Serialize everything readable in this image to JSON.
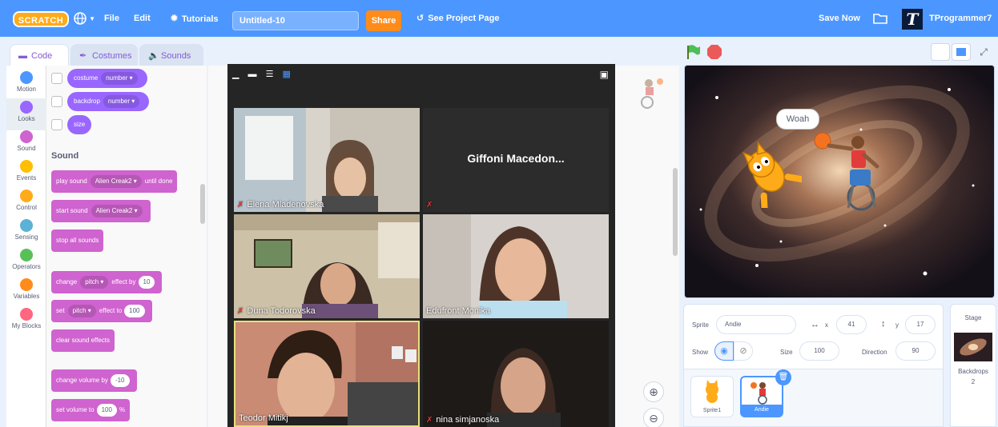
{
  "menu": {
    "logo": "SCRATCH",
    "file": "File",
    "edit": "Edit",
    "tutorials": "Tutorials",
    "project_title": "Untitled-10",
    "share": "Share",
    "see_project_page": "See Project Page",
    "save_now": "Save Now",
    "avatar_letter": "T",
    "username": "TProgrammer7"
  },
  "tabs": {
    "code": "Code",
    "costumes": "Costumes",
    "sounds": "Sounds"
  },
  "categories": [
    "Motion",
    "Looks",
    "Sound",
    "Events",
    "Control",
    "Sensing",
    "Operators",
    "Variables",
    "My Blocks"
  ],
  "category_colors": [
    "#4c97ff",
    "#9966ff",
    "#cf63cf",
    "#ffbf00",
    "#ffab19",
    "#5cb1d6",
    "#59c059",
    "#ff8c1a",
    "#ff6680"
  ],
  "looks_blocks": {
    "costume": "costume",
    "costume_opt": "number",
    "backdrop": "backdrop",
    "backdrop_opt": "number",
    "size": "size"
  },
  "sound_section": "Sound",
  "sound_blocks": {
    "play_sound": "play sound",
    "sound_name": "Alien Creak2",
    "until_done": "until done",
    "start_sound": "start sound",
    "start_sound_name": "Alien Creak2",
    "stop_all": "stop all sounds",
    "change": "change",
    "pitch": "pitch",
    "effect_by": "effect by",
    "effect_by_val": "10",
    "set": "set",
    "set_pitch": "pitch",
    "effect_to": "effect to",
    "effect_to_val": "100",
    "clear": "clear sound effects",
    "change_volume": "change volume by",
    "change_volume_val": "-10",
    "set_volume": "set volume to",
    "set_volume_val": "100",
    "percent": "%"
  },
  "video": {
    "participants": [
      {
        "name": "Elena Mladenovska",
        "muted": true
      },
      {
        "name": "Giffoni Macedon...",
        "muted": true
      },
      {
        "name": "Duna Todorovska",
        "muted": true
      },
      {
        "name": "Edufront Monika",
        "muted": false
      },
      {
        "name": "Teodor Mitikj",
        "muted": false
      },
      {
        "name": "nina simjanoska",
        "muted": true
      }
    ]
  },
  "stage": {
    "speech": "Woah"
  },
  "sprite_info": {
    "sprite_label": "Sprite",
    "sprite_name": "Andie",
    "x_label": "x",
    "x_value": "41",
    "y_label": "y",
    "y_value": "17",
    "show_label": "Show",
    "size_label": "Size",
    "size_value": "100",
    "direction_label": "Direction",
    "direction_value": "90"
  },
  "sprites": [
    {
      "name": "Sprite1"
    },
    {
      "name": "Andie"
    }
  ],
  "stage_panel": {
    "title": "Stage",
    "backdrops_label": "Backdrops",
    "backdrops_count": "2"
  },
  "colors": {
    "menubar": "#4c97ff",
    "looks": "#9966ff",
    "sound": "#cf63cf",
    "share": "#ff8c1a"
  }
}
